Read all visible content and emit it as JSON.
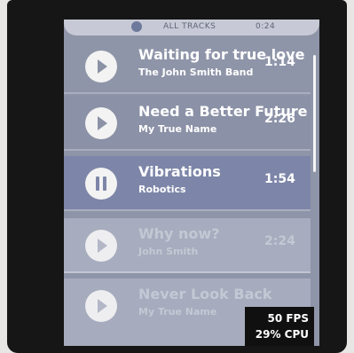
{
  "header": {
    "title": "ALL TRACKS",
    "time": "0:24"
  },
  "tracks": [
    {
      "title": "Waiting for true love",
      "artist": "The John Smith Band",
      "duration": "1:14",
      "state": "play"
    },
    {
      "title": "Need a Better Future",
      "artist": "My True Name",
      "duration": "2:26",
      "state": "play"
    },
    {
      "title": "Vibrations",
      "artist": "Robotics",
      "duration": "1:54",
      "state": "pause"
    },
    {
      "title": "Why now?",
      "artist": "John Smith",
      "duration": "2:24",
      "state": "play"
    },
    {
      "title": "Never Look Back",
      "artist": "My True Name",
      "duration": "",
      "state": "play"
    }
  ],
  "perf": {
    "fps": "50 FPS",
    "cpu": "29% CPU"
  },
  "colors": {
    "list_bg": "#8f95a8",
    "active_row": "#7d86a8",
    "faded_row": "#a7acbe",
    "text": "#ffffff"
  }
}
